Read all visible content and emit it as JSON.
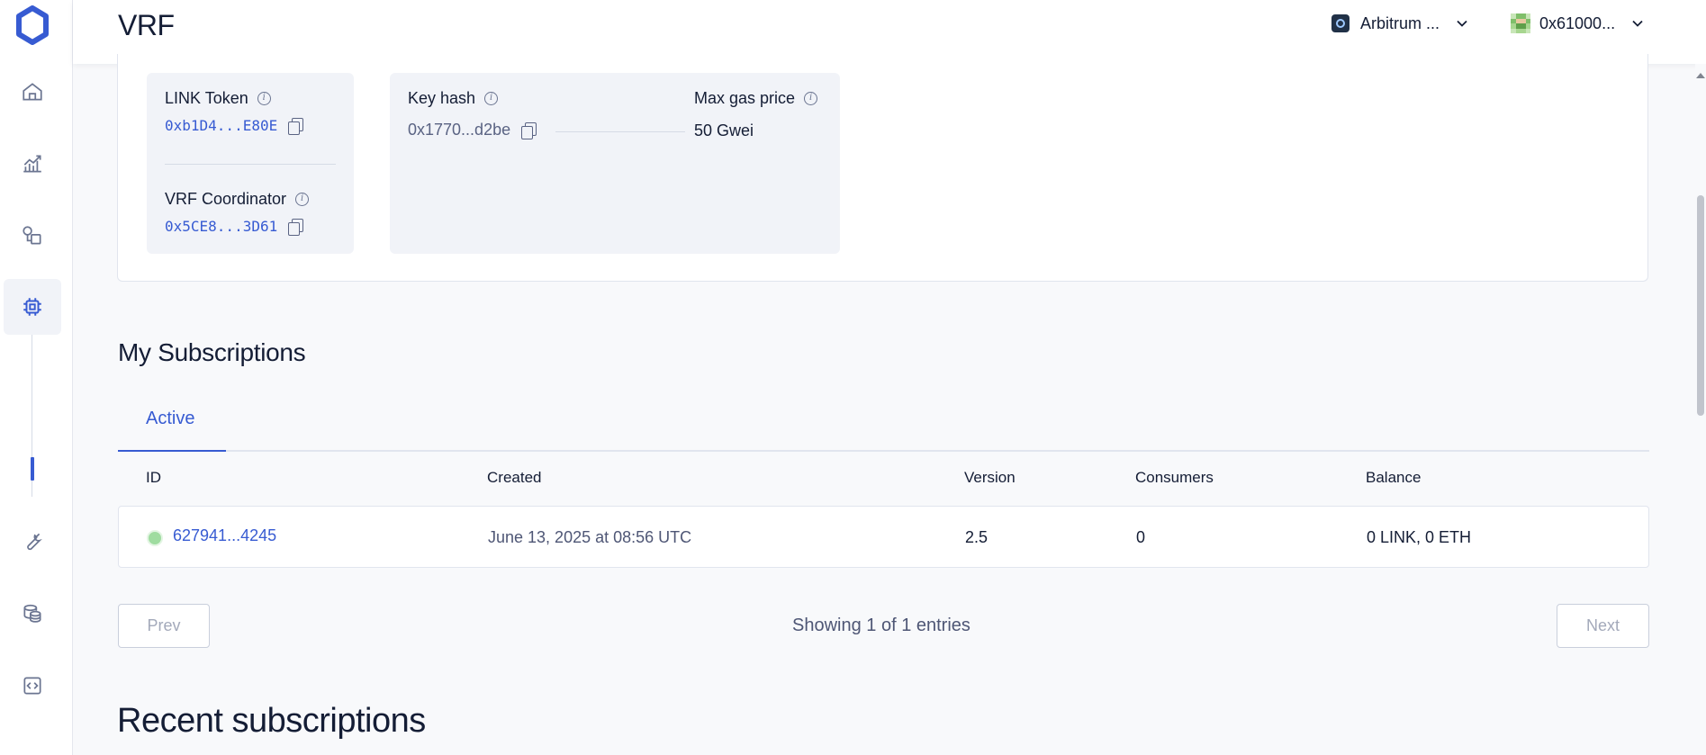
{
  "header": {
    "title": "VRF",
    "network": "Arbitrum ...",
    "wallet": "0x61000..."
  },
  "sidebar": {
    "items": [
      {
        "name": "home-icon"
      },
      {
        "name": "analytics-icon"
      },
      {
        "name": "shapes-icon"
      },
      {
        "name": "chip-icon",
        "active": true
      },
      {
        "name": "wrench-icon"
      },
      {
        "name": "coins-icon"
      },
      {
        "name": "code-icon"
      }
    ]
  },
  "details": {
    "link_token_label": "LINK Token",
    "link_token_address": "0xb1D4...E80E",
    "coordinator_label": "VRF Coordinator",
    "coordinator_address": "0x5CE8...3D61",
    "key_hash_label": "Key hash",
    "key_hash_value": "0x1770...d2be",
    "max_gas_label": "Max gas price",
    "max_gas_value": "50 Gwei"
  },
  "subscriptions": {
    "title": "My Subscriptions",
    "tab_active": "Active",
    "columns": {
      "id": "ID",
      "created": "Created",
      "version": "Version",
      "consumers": "Consumers",
      "balance": "Balance"
    },
    "rows": [
      {
        "id": "627941...4245",
        "created": "June 13, 2025 at 08:56 UTC",
        "version": "2.5",
        "consumers": "0",
        "balance": "0 LINK, 0 ETH"
      }
    ],
    "prev_label": "Prev",
    "next_label": "Next",
    "showing": "Showing 1 of 1 entries"
  },
  "recent": {
    "title": "Recent subscriptions"
  },
  "colors": {
    "accent": "#375bd2",
    "active_status": "#9fdca0",
    "text": "#141d35"
  }
}
